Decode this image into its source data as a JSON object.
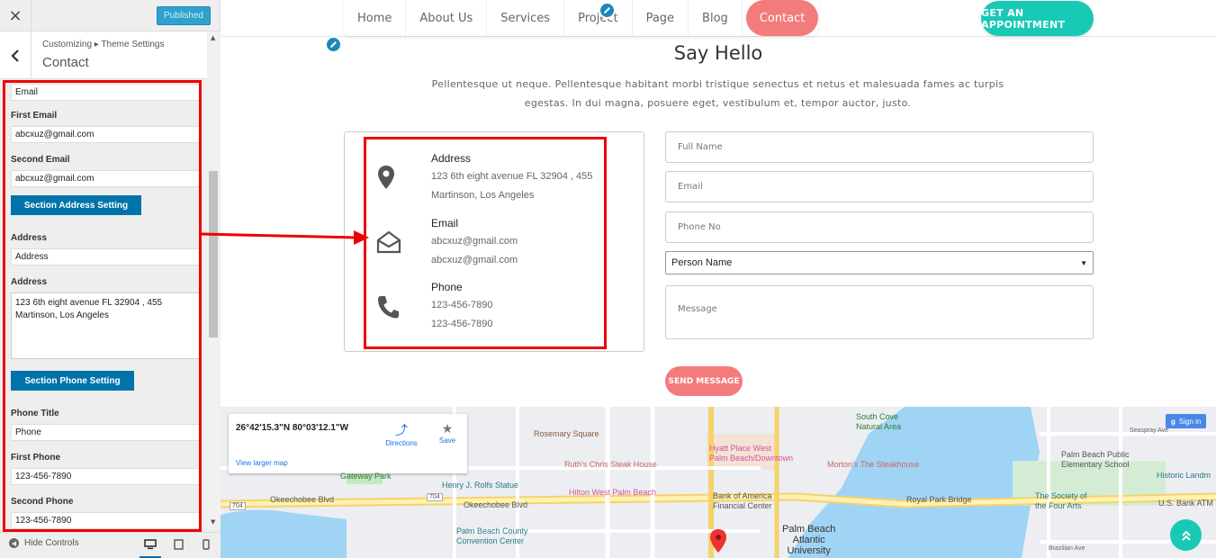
{
  "customizer": {
    "close_label": "×",
    "published_label": "Published",
    "breadcrumb": "Customizing ▸ Theme Settings",
    "title": "Contact",
    "fields": {
      "email_value": "Email",
      "first_email_label": "First Email",
      "first_email_value": "abcxuz@gmail.com",
      "second_email_label": "Second Email",
      "second_email_value": "abcxuz@gmail.com",
      "section_address_button": "Section Address Setting",
      "address_title_label": "Address",
      "address_title_value": "Address",
      "address_label": "Address",
      "address_line1": "123 6th eight avenue FL 32904 , 455",
      "address_line2": "Martinson, Los Angeles",
      "section_phone_button": "Section Phone Setting",
      "phone_title_label": "Phone Title",
      "phone_title_value": "Phone",
      "first_phone_label": "First Phone",
      "first_phone_value": "123-456-7890",
      "second_phone_label": "Second Phone",
      "second_phone_value": "123-456-7890"
    },
    "footer": {
      "hide_controls": "Hide Controls"
    }
  },
  "nav": {
    "items": [
      "Home",
      "About Us",
      "Services",
      "Project",
      "Page",
      "Blog"
    ],
    "active_item": "Contact",
    "cta": "GET AN APPOINTMENT"
  },
  "contact": {
    "heading": "Say Hello",
    "intro_line1": "Pellentesque ut neque. Pellentesque habitant morbi tristique senectus et netus et malesuada fames ac turpis",
    "intro_line2": "egestas. In dui magna, posuere eget, vestibulum et, tempor auctor, justo.",
    "address": {
      "title": "Address",
      "line1": "123 6th eight avenue FL 32904 , 455",
      "line2": "Martinson, Los Angeles"
    },
    "email": {
      "title": "Email",
      "line1": "abcxuz@gmail.com",
      "line2": "abcxuz@gmail.com"
    },
    "phone": {
      "title": "Phone",
      "line1": "123-456-7890",
      "line2": "123-456-7890"
    }
  },
  "form": {
    "full_name_placeholder": "Full Name",
    "email_placeholder": "Email",
    "phone_placeholder": "Phone No",
    "person_select": "Person Name",
    "message_placeholder": "Message",
    "send_label": "SEND MESSAGE"
  },
  "map": {
    "coords": "26°42'15.3\"N 80°03'12.1\"W",
    "directions": "Directions",
    "save": "Save",
    "larger_map": "View larger map",
    "sign_in": "Sign in",
    "labels": {
      "rosemary": "Rosemary Square",
      "hyatt1": "Hyatt Place West",
      "hyatt2": "Palm Beach/Downtown",
      "ruths": "Ruth's Chris Steak House",
      "mortons": "Morton's The Steakhouse",
      "south_cove1": "South Cove",
      "south_cove2": "Natural Area",
      "seaspray": "Seaspray Ave",
      "pbps1": "Palm Beach Public",
      "pbps2": "Elementary School",
      "historic": "Historic Landm",
      "gateway": "Gateway Park",
      "rolfs": "Henry J. Rolfs Statue",
      "hilton": "Hilton West Palm Beach",
      "boa1": "Bank of America",
      "boa2": "Financial Center",
      "royal": "Royal Park Bridge",
      "society1": "The Society of",
      "society2": "the Four Arts",
      "usbank": "U.S. Bank ATM",
      "okee1": "Okeechobee Blvd",
      "okee2": "Okeechobee Blvd",
      "pbcc1": "Palm Beach County",
      "pbcc2": "Convention Center",
      "pau1": "Palm Beach",
      "pau2": "Atlantic",
      "pau3": "University",
      "brazilian": "Brazilian Ave",
      "r704a": "704",
      "r704b": "704"
    }
  },
  "colors": {
    "accent_coral": "#f47b7b",
    "accent_teal": "#18c9b6",
    "wp_blue": "#0073aa",
    "highlight_red": "#e00000"
  }
}
